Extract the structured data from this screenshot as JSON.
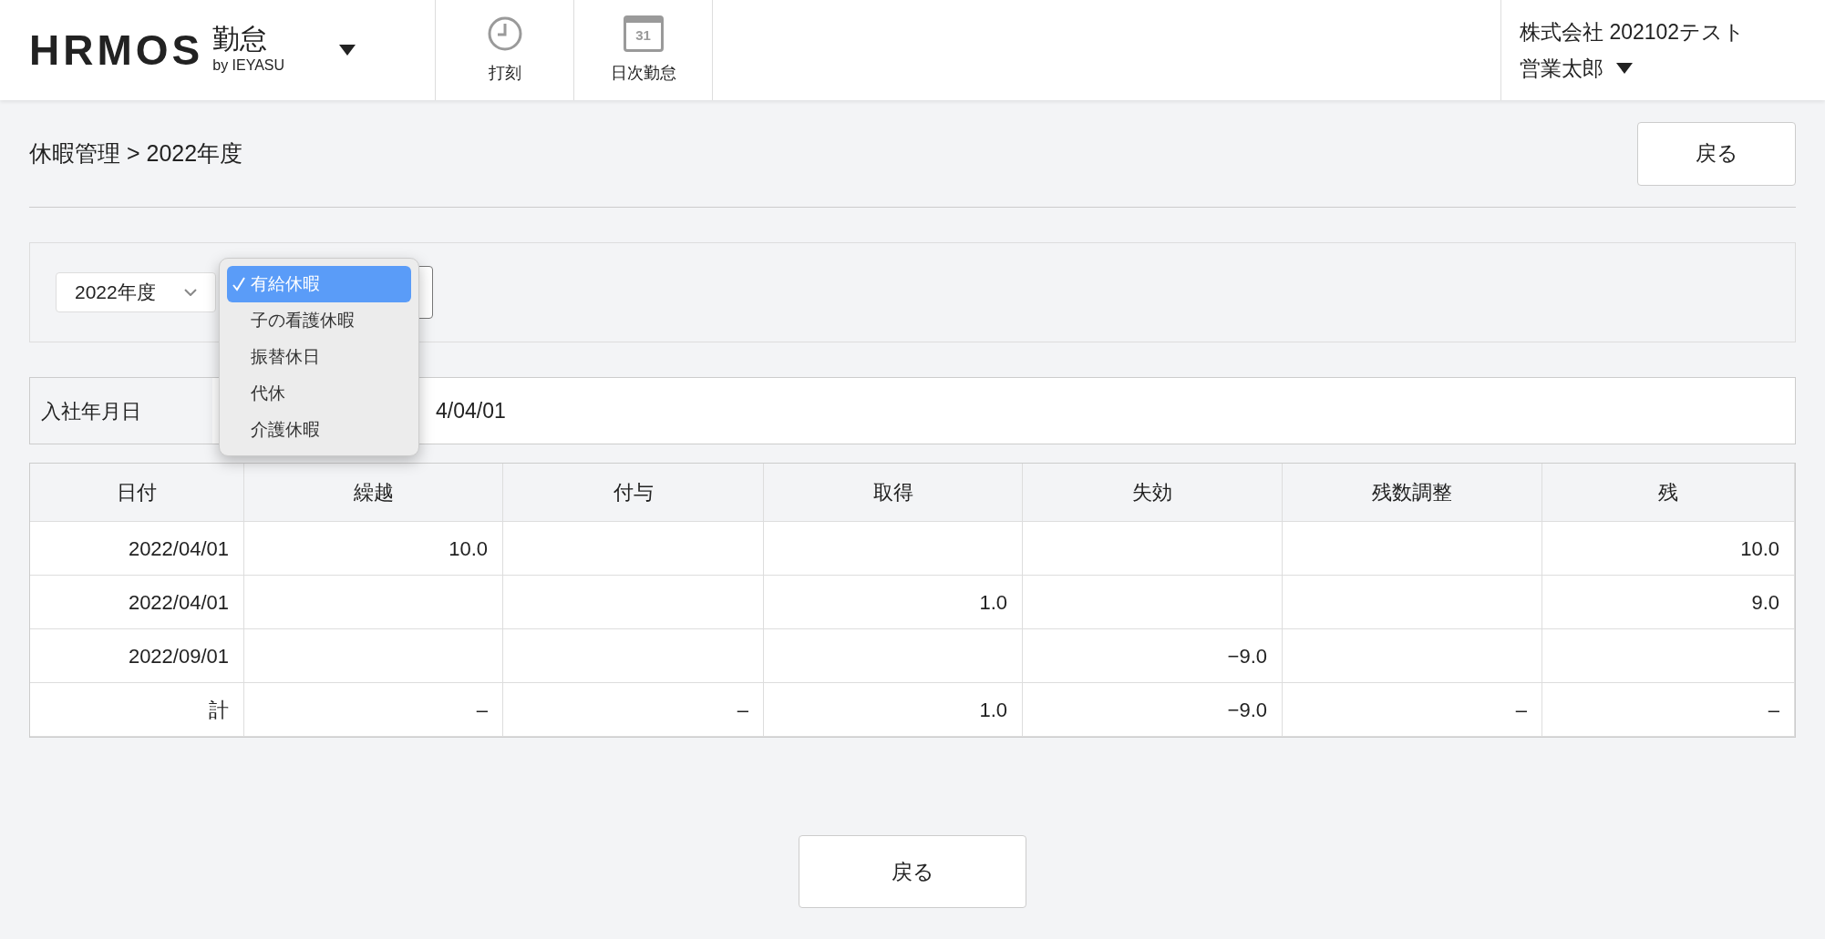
{
  "header": {
    "logo": "HRMOS",
    "product": "勤怠",
    "byline": "by IEYASU",
    "nav": [
      {
        "kind": "clock",
        "label": "打刻"
      },
      {
        "kind": "calendar",
        "label": "日次勤怠",
        "icon_text": "31"
      }
    ],
    "company": "株式会社 202102テスト",
    "user": "営業太郎"
  },
  "breadcrumb": "休暇管理 > 2022年度",
  "back_button": "戻る",
  "filters": {
    "year": "2022年度",
    "type_menu": [
      {
        "label": "有給休暇",
        "selected": true
      },
      {
        "label": "子の看護休暇",
        "selected": false
      },
      {
        "label": "振替休日",
        "selected": false
      },
      {
        "label": "代休",
        "selected": false
      },
      {
        "label": "介護休暇",
        "selected": false
      }
    ]
  },
  "hire_date": {
    "label": "入社年月日",
    "value": "4/04/01"
  },
  "table": {
    "columns": [
      "日付",
      "繰越",
      "付与",
      "取得",
      "失効",
      "残数調整",
      "残"
    ],
    "rows": [
      [
        "2022/04/01",
        "10.0",
        "",
        "",
        "",
        "",
        "10.0"
      ],
      [
        "2022/04/01",
        "",
        "",
        "1.0",
        "",
        "",
        "9.0"
      ],
      [
        "2022/09/01",
        "",
        "",
        "",
        "−9.0",
        "",
        ""
      ],
      [
        "計",
        "–",
        "–",
        "1.0",
        "−9.0",
        "–",
        "–"
      ]
    ]
  },
  "bottom_button": "戻る"
}
